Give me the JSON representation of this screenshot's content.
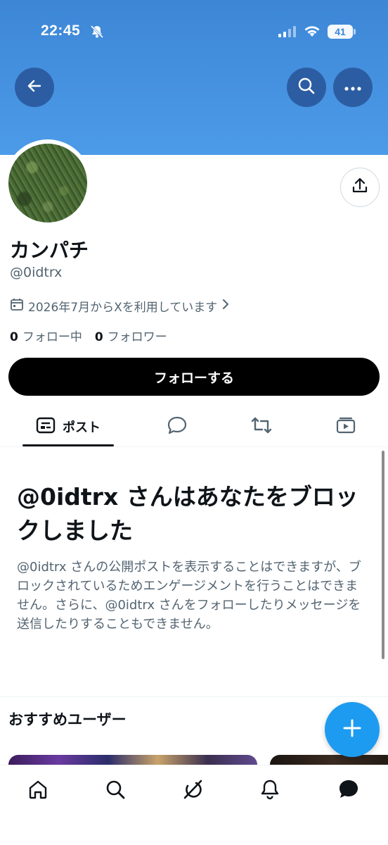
{
  "status_bar": {
    "time": "22:45",
    "battery": "41",
    "icons": [
      "bell-muted-icon",
      "signal-icon",
      "wifi-icon",
      "battery-icon"
    ]
  },
  "header": {
    "banner_color": "#4c9be8",
    "buttons": [
      "back-arrow-icon",
      "search-icon",
      "more-icon"
    ]
  },
  "profile": {
    "display_name": "カンパチ",
    "handle": "@0idtrx",
    "joined": "2026年7月からXを利用しています",
    "following_count": "0",
    "following_label": "フォロー中",
    "followers_count": "0",
    "followers_label": "フォロワー",
    "follow_button": "フォローする"
  },
  "tabs": [
    {
      "label": "ポスト",
      "icon": "posts-icon",
      "active": true
    },
    {
      "label": "",
      "icon": "reply-bubble-icon",
      "active": false
    },
    {
      "label": "",
      "icon": "repost-icon",
      "active": false
    },
    {
      "label": "",
      "icon": "media-video-icon",
      "active": false
    }
  ],
  "blocked": {
    "title": "@0idtrx さんはあなたをブロックしました",
    "body": "@0idtrx さんの公開ポストを表示することはできますが、ブロックされているためエンゲージメントを行うことはできません。さらに、@0idtrx さんをフォローしたりメッセージを送信したりすることもできません。"
  },
  "recommendations": {
    "title": "おすすめユーザー"
  },
  "fab_icon": "plus-icon",
  "bottom_nav": [
    "home-icon",
    "search-icon",
    "grok-icon",
    "notifications-icon",
    "messages-icon"
  ],
  "colors": {
    "accent": "#1d9bf0",
    "text": "#0f1419",
    "muted": "#536471",
    "header_button": "#2c5da3"
  }
}
